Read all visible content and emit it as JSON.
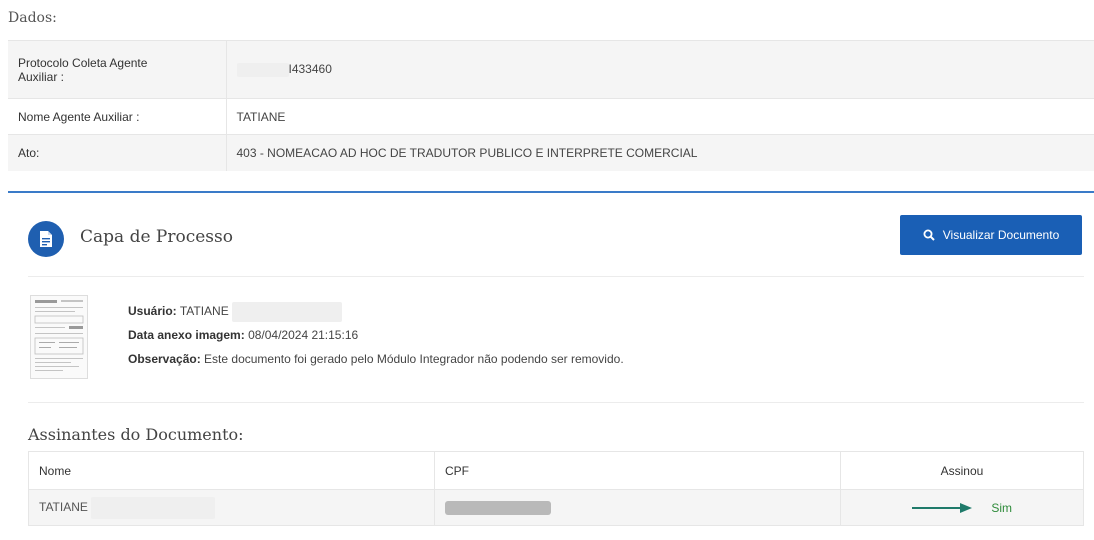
{
  "section_title": "Dados:",
  "fields": [
    {
      "label_line1": "Protocolo Coleta Agente",
      "label_line2": "Auxiliar :",
      "value": "I433460"
    },
    {
      "label": "Nome Agente Auxiliar :",
      "value": "TATIANE"
    },
    {
      "label": "Ato:",
      "value": "403 - NOMEACAO AD HOC DE TRADUTOR PUBLICO E INTERPRETE COMERCIAL"
    }
  ],
  "panel": {
    "title": "Capa de Processo",
    "view_button_label": "Visualizar Documento"
  },
  "attachment": {
    "user_label": "Usuário:",
    "user_value": "TATIANE",
    "date_label": "Data anexo imagem:",
    "date_value": "08/04/2024 21:15:16",
    "obs_label": "Observação:",
    "obs_value": "Este documento foi gerado pelo Módulo Integrador não podendo ser removido."
  },
  "signers": {
    "title": "Assinantes do Documento:",
    "columns": [
      "Nome",
      "CPF",
      "Assinou"
    ],
    "rows": [
      {
        "name": "TATIANE",
        "signed": "Sim"
      }
    ]
  },
  "colors": {
    "accent": "#1a5fb5",
    "panel_border": "#3a7bc8",
    "signed": "#2e8b3a",
    "arrow": "#1f7a6a"
  },
  "icons": {
    "panel": "document-icon",
    "button": "search-icon",
    "arrow": "arrow-right-icon"
  }
}
